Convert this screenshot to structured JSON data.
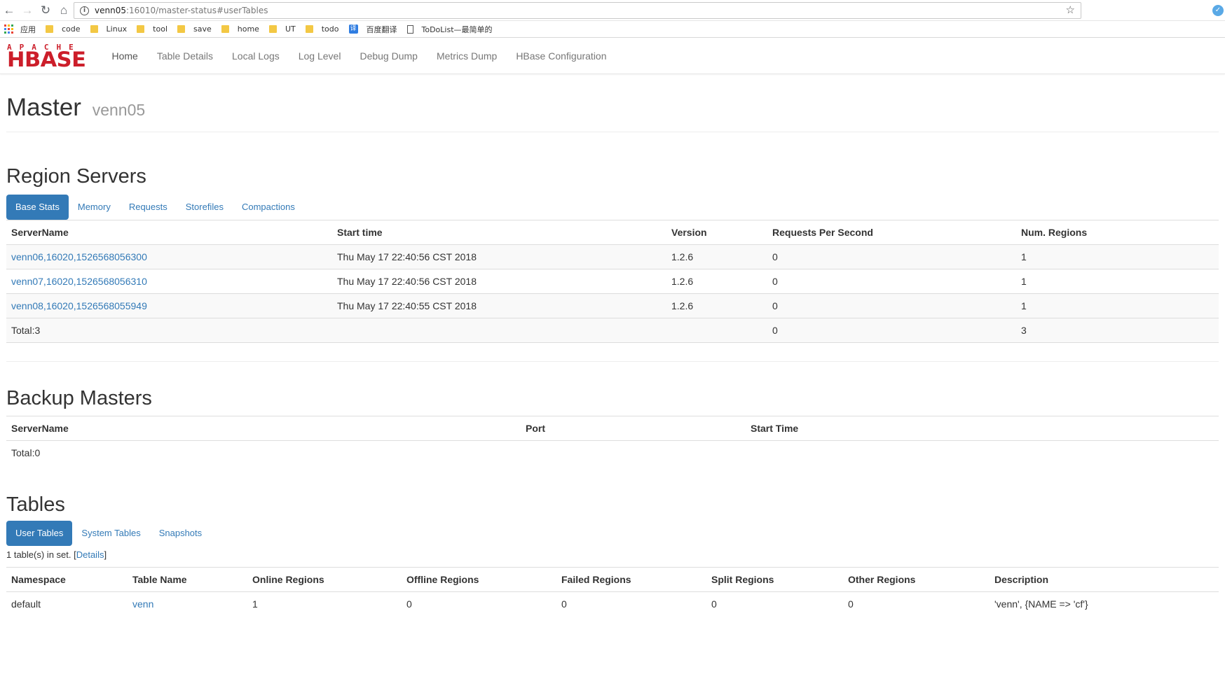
{
  "browser": {
    "url_host": "venn05",
    "url_rest": ":16010/master-status#userTables",
    "bookmarks": [
      {
        "label": "应用",
        "icon": "apps-icon"
      },
      {
        "label": "code",
        "icon": "folder-icon"
      },
      {
        "label": "Linux",
        "icon": "folder-icon"
      },
      {
        "label": "tool",
        "icon": "folder-icon"
      },
      {
        "label": "save",
        "icon": "folder-icon"
      },
      {
        "label": "home",
        "icon": "folder-icon"
      },
      {
        "label": "UT",
        "icon": "folder-icon"
      },
      {
        "label": "todo",
        "icon": "folder-icon"
      },
      {
        "label": "百度翻译",
        "icon": "translate-icon"
      },
      {
        "label": "ToDoList—最简单的",
        "icon": "page-icon"
      }
    ]
  },
  "navbar": {
    "logo_top": "APACHE",
    "logo_main": "HBASE",
    "links": [
      "Home",
      "Table Details",
      "Local Logs",
      "Log Level",
      "Debug Dump",
      "Metrics Dump",
      "HBase Configuration"
    ]
  },
  "header": {
    "title": "Master",
    "subtitle": "venn05"
  },
  "region_servers": {
    "title": "Region Servers",
    "tabs": [
      "Base Stats",
      "Memory",
      "Requests",
      "Storefiles",
      "Compactions"
    ],
    "columns": [
      "ServerName",
      "Start time",
      "Version",
      "Requests Per Second",
      "Num. Regions"
    ],
    "rows": [
      [
        "venn06,16020,1526568056300",
        "Thu May 17 22:40:56 CST 2018",
        "1.2.6",
        "0",
        "1"
      ],
      [
        "venn07,16020,1526568056310",
        "Thu May 17 22:40:56 CST 2018",
        "1.2.6",
        "0",
        "1"
      ],
      [
        "venn08,16020,1526568055949",
        "Thu May 17 22:40:55 CST 2018",
        "1.2.6",
        "0",
        "1"
      ]
    ],
    "total": {
      "label": "Total:3",
      "requests": "0",
      "regions": "3"
    }
  },
  "backup_masters": {
    "title": "Backup Masters",
    "columns": [
      "ServerName",
      "Port",
      "Start Time"
    ],
    "total": "Total:0"
  },
  "tables": {
    "title": "Tables",
    "tabs": [
      "User Tables",
      "System Tables",
      "Snapshots"
    ],
    "info_prefix": "1 table(s) in set. [",
    "info_link": "Details",
    "info_suffix": "]",
    "columns": [
      "Namespace",
      "Table Name",
      "Online Regions",
      "Offline Regions",
      "Failed Regions",
      "Split Regions",
      "Other Regions",
      "Description"
    ],
    "rows": [
      [
        "default",
        "venn",
        "1",
        "0",
        "0",
        "0",
        "0",
        "'venn', {NAME => 'cf'}"
      ]
    ]
  },
  "colors": {
    "accent": "#337ab7",
    "brand": "#cc1e2a"
  }
}
